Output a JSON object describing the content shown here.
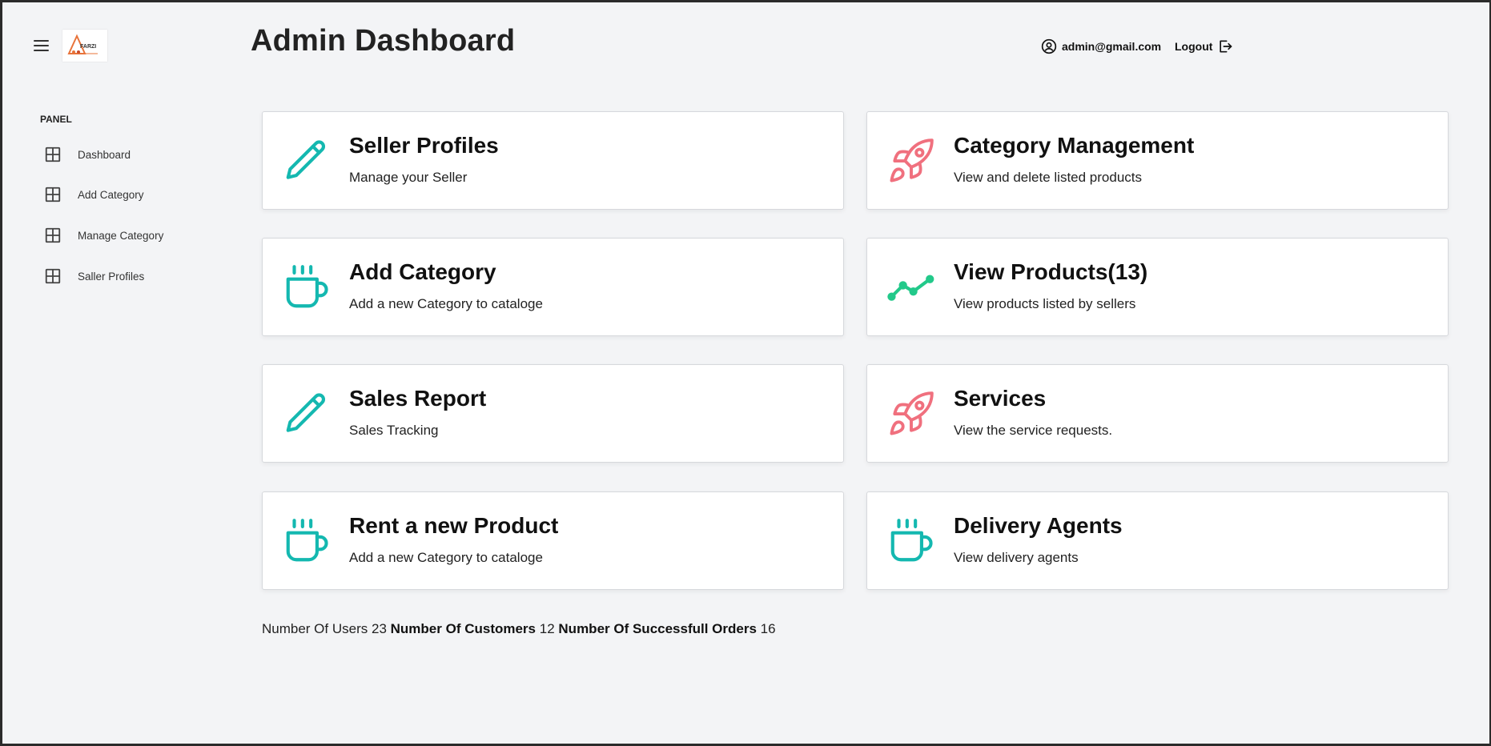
{
  "header": {
    "title": "Admin Dashboard",
    "user_email": "admin@gmail.com",
    "logout_label": "Logout",
    "logo_text": "FARZI"
  },
  "sidebar": {
    "panel_label": "PANEL",
    "items": [
      {
        "label": "Dashboard"
      },
      {
        "label": "Add Category"
      },
      {
        "label": "Manage Category"
      },
      {
        "label": "Saller Profiles"
      }
    ]
  },
  "cards": [
    {
      "title": "Seller Profiles",
      "subtitle": "Manage your Seller",
      "icon": "pencil-icon"
    },
    {
      "title": "Category Management",
      "subtitle": "View and delete listed products",
      "icon": "rocket-icon"
    },
    {
      "title": "Add Category",
      "subtitle": "Add a new Category to cataloge",
      "icon": "cup-icon"
    },
    {
      "title": "View Products(13)",
      "subtitle": "View products listed by sellers",
      "icon": "trend-icon"
    },
    {
      "title": "Sales Report",
      "subtitle": "Sales Tracking",
      "icon": "pencil-icon"
    },
    {
      "title": "Services",
      "subtitle": "View the service requests.",
      "icon": "rocket-icon"
    },
    {
      "title": "Rent a new Product",
      "subtitle": "Add a new Category to cataloge",
      "icon": "cup-icon"
    },
    {
      "title": "Delivery Agents",
      "subtitle": "View delivery agents",
      "icon": "cup-icon"
    }
  ],
  "stats": {
    "users_label": "Number Of Users",
    "users_value": "23",
    "customers_label": "Number Of Customers",
    "customers_value": "12",
    "orders_label": "Number Of Successfull Orders",
    "orders_value": "16"
  },
  "colors": {
    "teal": "#14b8b0",
    "pink": "#f0707e",
    "green": "#22c98a",
    "background": "#f3f4f6"
  }
}
